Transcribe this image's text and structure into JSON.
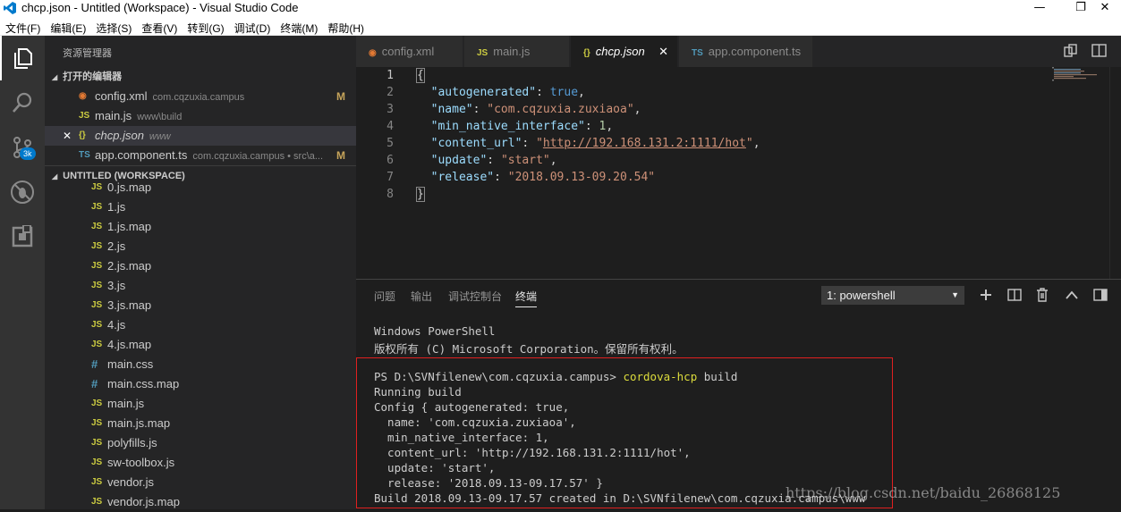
{
  "window": {
    "title": "chcp.json - Untitled (Workspace) - Visual Studio Code",
    "minimize": "—",
    "restore": "❐",
    "close": "✕"
  },
  "menu": [
    "文件(F)",
    "编辑(E)",
    "选择(S)",
    "查看(V)",
    "转到(G)",
    "调试(D)",
    "终端(M)",
    "帮助(H)"
  ],
  "activity_bar": {
    "badge": "3k",
    "icons": [
      "files-icon",
      "search-icon",
      "source-control-icon",
      "debug-icon",
      "extensions-icon"
    ]
  },
  "sidebar": {
    "title": "资源管理器",
    "open_editors": {
      "header": "打开的编辑器",
      "items": [
        {
          "icon": "rss",
          "name": "config.xml",
          "desc": "com.cqzuxia.campus",
          "badge": "M"
        },
        {
          "icon": "JS",
          "name": "main.js",
          "desc": "www\\build",
          "badge": ""
        },
        {
          "icon": "{}",
          "name": "chcp.json",
          "desc": "www",
          "badge": "",
          "close": "✕"
        },
        {
          "icon": "TS",
          "name": "app.component.ts",
          "desc": "com.cqzuxia.campus • src\\a...",
          "badge": "M"
        }
      ]
    },
    "workspace": {
      "header": "UNTITLED (WORKSPACE)",
      "files": [
        {
          "icon": "JS",
          "name": "0.js.map"
        },
        {
          "icon": "JS",
          "name": "1.js"
        },
        {
          "icon": "JS",
          "name": "1.js.map"
        },
        {
          "icon": "JS",
          "name": "2.js"
        },
        {
          "icon": "JS",
          "name": "2.js.map"
        },
        {
          "icon": "JS",
          "name": "3.js"
        },
        {
          "icon": "JS",
          "name": "3.js.map"
        },
        {
          "icon": "JS",
          "name": "4.js"
        },
        {
          "icon": "JS",
          "name": "4.js.map"
        },
        {
          "icon": "#",
          "name": "main.css"
        },
        {
          "icon": "#",
          "name": "main.css.map"
        },
        {
          "icon": "JS",
          "name": "main.js"
        },
        {
          "icon": "JS",
          "name": "main.js.map"
        },
        {
          "icon": "JS",
          "name": "polyfills.js"
        },
        {
          "icon": "JS",
          "name": "sw-toolbox.js"
        },
        {
          "icon": "JS",
          "name": "vendor.js"
        },
        {
          "icon": "JS",
          "name": "vendor.js.map"
        }
      ]
    }
  },
  "tabs": [
    {
      "icon": "rss",
      "label": "config.xml"
    },
    {
      "icon": "JS",
      "label": "main.js"
    },
    {
      "icon": "{}",
      "label": "chcp.json",
      "close": "✕"
    },
    {
      "icon": "TS",
      "label": "app.component.ts"
    }
  ],
  "editor": {
    "line_numbers": [
      "1",
      "2",
      "3",
      "4",
      "5",
      "6",
      "7",
      "8"
    ],
    "code": {
      "open": "{",
      "close": "}",
      "autogenerated_key": "\"autogenerated\"",
      "autogenerated_val": "true",
      "name_key": "\"name\"",
      "name_val": "\"com.cqzuxia.zuxiaoa\"",
      "min_key": "\"min_native_interface\"",
      "min_val": "1",
      "url_key": "\"content_url\"",
      "url_q1": "\"",
      "url_val": "http://192.168.131.2:1111/hot",
      "url_q2": "\"",
      "update_key": "\"update\"",
      "update_val": "\"start\"",
      "release_key": "\"release\"",
      "release_val": "\"2018.09.13-09.20.54\""
    }
  },
  "panel": {
    "tabs": [
      "问题",
      "输出",
      "调试控制台",
      "终端"
    ],
    "terminal_select": "1: powershell",
    "lines": [
      "Windows PowerShell",
      "版权所有 (C) Microsoft Corporation。保留所有权利。",
      "",
      "PS D:\\SVNfilenew\\com.cqzuxia.campus> ",
      "Running build",
      "Config { autogenerated: true,",
      "  name: 'com.cqzuxia.zuxiaoa',",
      "  min_native_interface: 1,",
      "  content_url: 'http://192.168.131.2:1111/hot',",
      "  update: 'start',",
      "  release: '2018.09.13-09.17.57' }",
      "Build 2018.09.13-09.17.57 created in D:\\SVNfilenew\\com.cqzuxia.campus\\www"
    ],
    "command": "cordova-hcp",
    "command_arg": " build"
  },
  "watermark": "https://blog.csdn.net/baidu_26868125",
  "colors": {
    "accent": "#007acc",
    "highlight_box": "#e02020",
    "modified": "#c5a35a"
  }
}
